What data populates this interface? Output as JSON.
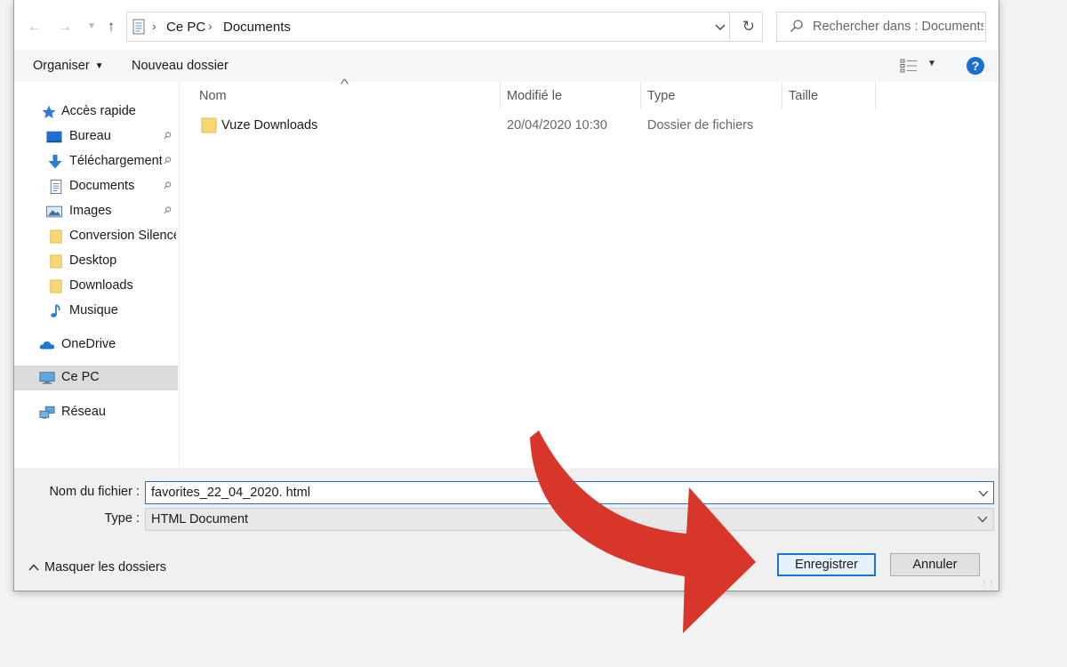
{
  "nav": {
    "breadcrumb": [
      "Ce PC",
      "Documents"
    ],
    "search_placeholder": "Rechercher dans : Documents"
  },
  "toolbar": {
    "organize_label": "Organiser",
    "new_folder_label": "Nouveau dossier"
  },
  "sidebar": {
    "items": [
      {
        "label": "Accès rapide",
        "icon": "star-icon",
        "pinned": false
      },
      {
        "label": "Bureau",
        "icon": "desktop-icon",
        "pinned": true
      },
      {
        "label": "Téléchargements",
        "icon": "download-arrow-icon",
        "pinned": true
      },
      {
        "label": "Documents",
        "icon": "document-icon",
        "pinned": true
      },
      {
        "label": "Images",
        "icon": "image-icon",
        "pinned": true
      },
      {
        "label": "Conversion Silence",
        "icon": "folder-icon",
        "pinned": false
      },
      {
        "label": "Desktop",
        "icon": "folder-icon",
        "pinned": false
      },
      {
        "label": "Downloads",
        "icon": "folder-icon",
        "pinned": false
      },
      {
        "label": "Musique",
        "icon": "music-note-icon",
        "pinned": false
      },
      {
        "label": "OneDrive",
        "icon": "cloud-icon",
        "pinned": false
      },
      {
        "label": "Ce PC",
        "icon": "computer-icon",
        "pinned": false,
        "selected": true
      },
      {
        "label": "Réseau",
        "icon": "network-icon",
        "pinned": false
      }
    ]
  },
  "columns": [
    "Nom",
    "Modifié le",
    "Type",
    "Taille"
  ],
  "files": [
    {
      "name": "Vuze Downloads",
      "modified": "20/04/2020 10:30",
      "type": "Dossier de fichiers",
      "size": ""
    }
  ],
  "save": {
    "filename_label": "Nom du fichier :",
    "filename_value": "favorites_22_04_2020. html",
    "type_label": "Type :",
    "type_value": "HTML Document",
    "hide_folders_label": "Masquer les dossiers",
    "save_button": "Enregistrer",
    "cancel_button": "Annuler"
  },
  "colors": {
    "accent": "#1c72d6",
    "arrow": "#d9362b",
    "folder": "#f8d775"
  }
}
